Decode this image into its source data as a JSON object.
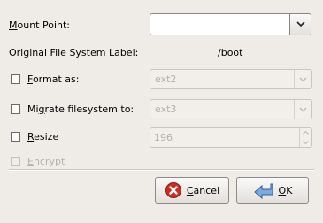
{
  "mount_point": {
    "label": "Mount Point:",
    "label_underline": "M",
    "label_rest": "ount Point:",
    "value": ""
  },
  "fs_label": {
    "label": "Original File System Label:",
    "value": "/boot"
  },
  "format": {
    "label_underline": "F",
    "label_rest": "ormat as:",
    "selected": "ext2",
    "checked": false
  },
  "migrate": {
    "label_pre": "Mi",
    "label_underline": "g",
    "label_rest": "rate filesystem to:",
    "selected": "ext3",
    "checked": false
  },
  "resize": {
    "label_underline": "R",
    "label_rest": "esize",
    "value": "196",
    "checked": false
  },
  "encrypt": {
    "label_underline": "E",
    "label_rest": "ncrypt",
    "checked": false,
    "enabled": false
  },
  "buttons": {
    "cancel": {
      "underline": "C",
      "rest": "ancel",
      "icon": "cancel-icon",
      "icon_color": "#d42a1d"
    },
    "ok": {
      "underline": "O",
      "rest": "K",
      "icon": "ok-arrow-icon",
      "icon_color": "#5a8fd0"
    }
  }
}
